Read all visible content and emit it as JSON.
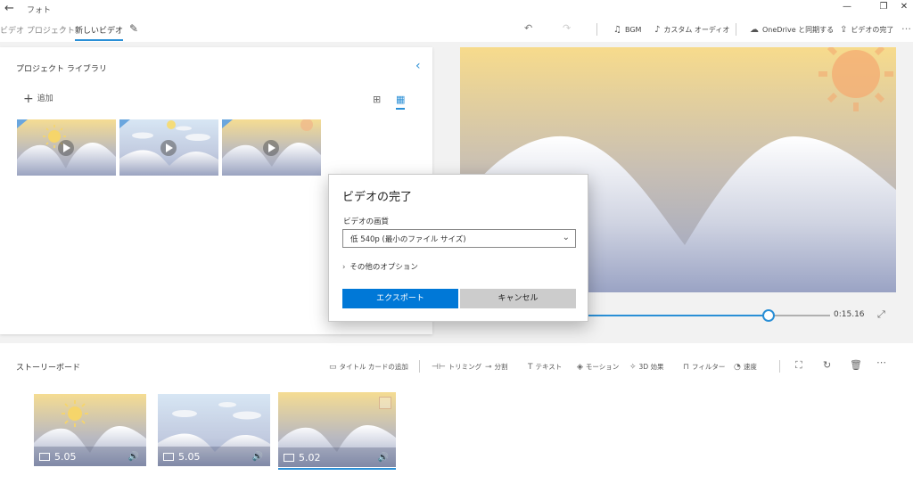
{
  "titlebar": {
    "back_icon": "←",
    "title": "フォト",
    "minimize_icon": "—",
    "restore_icon": "❐",
    "close_icon": "✕"
  },
  "cmdbar": {
    "breadcrumb_parent": "ビデオ プロジェクト",
    "breadcrumb_sep": "›",
    "breadcrumb_current": "新しいビデオ",
    "undo_icon": "↶",
    "redo_icon": "↷",
    "bgm_label": "BGM",
    "custom_audio_label": "カスタム オーディオ",
    "onedrive_label": "OneDrive と同期する",
    "finish_label": "ビデオの完了",
    "more_icon": "…"
  },
  "library": {
    "title": "プロジェクト ライブラリ",
    "add_label": "追加",
    "collapse_icon": "‹"
  },
  "preview": {
    "time": "0:15.16",
    "progress_fraction": 0.75
  },
  "storyboard": {
    "title": "ストーリーボード",
    "tools": {
      "title_card": "タイトル カードの追加",
      "trim": "トリミング",
      "split": "分割",
      "text": "テキスト",
      "motion": "モーション",
      "effects3d": "3D 効果",
      "filter": "フィルター",
      "speed": "速度"
    },
    "clips": [
      {
        "duration": "5.05"
      },
      {
        "duration": "5.05"
      },
      {
        "duration": "5.02"
      }
    ]
  },
  "dialog": {
    "title": "ビデオの完了",
    "quality_label": "ビデオの画質",
    "quality_value": "低 540p (最小のファイル サイズ)",
    "more_options": "その他のオプション",
    "export_label": "エクスポート",
    "cancel_label": "キャンセル"
  },
  "colors": {
    "accent": "#0078d7",
    "link_blue": "#2a8fd6"
  }
}
